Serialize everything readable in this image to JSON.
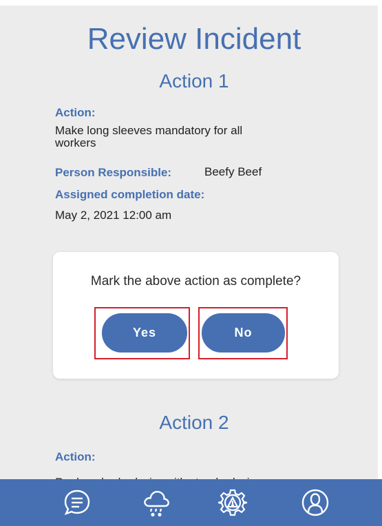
{
  "header": {
    "title": "Review Incident"
  },
  "actions": [
    {
      "heading": "Action 1",
      "action_label": "Action:",
      "action_text_line1": "Make long sleeves mandatory for all",
      "action_text_line2": "workers",
      "person_label": "Person Responsible:",
      "person_value": "Beefy Beef",
      "date_label": "Assigned completion date:",
      "date_value": "May 2, 2021 12:00 am"
    },
    {
      "heading": "Action 2",
      "action_label": "Action:",
      "action_text_line1": "Replace barbed wire with standard wire"
    }
  ],
  "dialog": {
    "message": "Mark the above action as complete?",
    "yes_label": "Yes",
    "no_label": "No"
  },
  "nav": {
    "items": [
      {
        "icon": "chat-icon"
      },
      {
        "icon": "weather-icon"
      },
      {
        "icon": "hazard-settings-icon"
      },
      {
        "icon": "profile-icon"
      }
    ]
  },
  "colors": {
    "primary": "#4670b2",
    "highlight_box": "#d41f2a",
    "background": "#ececec"
  }
}
